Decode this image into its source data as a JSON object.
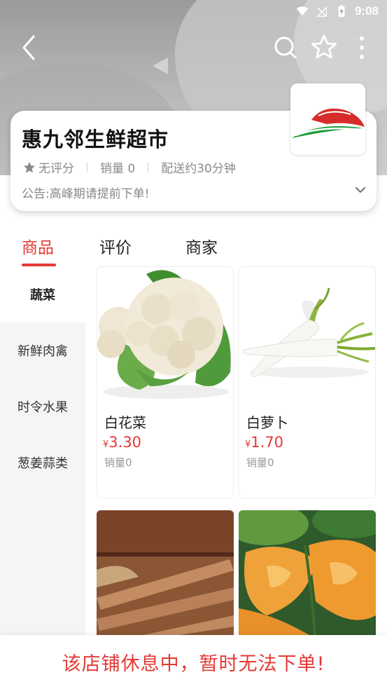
{
  "status_bar": {
    "time": "9:08"
  },
  "store": {
    "name": "惠九邻生鲜超市",
    "rating": "无评分",
    "sales": "销量 0",
    "delivery": "配送约30分钟",
    "notice": "公告:高峰期请提前下单!"
  },
  "tabs": [
    {
      "label": "商品"
    },
    {
      "label": "评价"
    },
    {
      "label": "商家"
    }
  ],
  "categories": [
    {
      "label": "蔬菜"
    },
    {
      "label": "新鲜肉禽"
    },
    {
      "label": "时令水果"
    },
    {
      "label": "葱姜蒜类"
    }
  ],
  "products": [
    {
      "name": "白花菜",
      "currency": "¥",
      "price": "3.30",
      "sales": "销量0"
    },
    {
      "name": "白萝卜",
      "currency": "¥",
      "price": "1.70",
      "sales": "销量0"
    }
  ],
  "closed_message": "该店铺休息中，暂时无法下单!",
  "colors": {
    "accent": "#e53935",
    "sidebar_bg": "#f5f5f5"
  }
}
